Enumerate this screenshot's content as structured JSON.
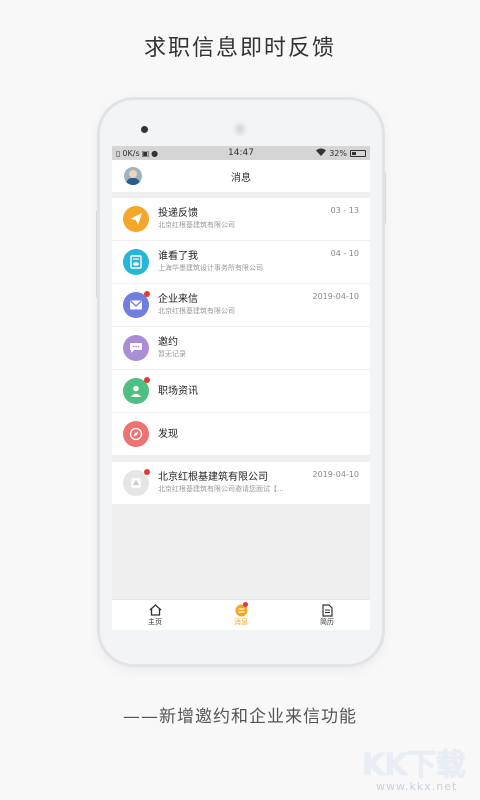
{
  "promo": {
    "headline": "求职信息即时反馈",
    "footline": "——新增邀约和企业来信功能"
  },
  "status_bar": {
    "net_speed": "0K/s",
    "time": "14:47",
    "battery": "32%"
  },
  "header": {
    "title": "消息"
  },
  "messages": [
    {
      "title": "投递反馈",
      "subtitle": "北京红根基建筑有限公司",
      "date": "03 - 13",
      "icon": "paper-plane-icon",
      "color": "#f5a72a",
      "unread": false
    },
    {
      "title": "谁看了我",
      "subtitle": "上海华墨建筑设计事务所有限公司",
      "date": "04 - 10",
      "icon": "eye-document-icon",
      "color": "#29b6d6",
      "unread": false
    },
    {
      "title": "企业来信",
      "subtitle": "北京红根基建筑有限公司",
      "date": "2019-04-10",
      "icon": "envelope-icon",
      "color": "#6f7ee0",
      "unread": true
    },
    {
      "title": "邀约",
      "subtitle": "暂无记录",
      "date": "",
      "icon": "chat-bubble-icon",
      "color": "#a98ed6",
      "unread": false
    },
    {
      "title": "职场资讯",
      "subtitle": "",
      "date": "",
      "icon": "person-icon",
      "color": "#4dbf80",
      "unread": true
    },
    {
      "title": "发现",
      "subtitle": "",
      "date": "",
      "icon": "compass-icon",
      "color": "#ef7272",
      "unread": false
    }
  ],
  "company_message": {
    "title": "北京红根基建筑有限公司",
    "subtitle": "北京红根基建筑有限公司邀请您面试【...",
    "date": "2019-04-10",
    "icon": "company-logo-icon",
    "unread": true
  },
  "tabs": [
    {
      "label": "主页",
      "icon": "home-icon",
      "active": false
    },
    {
      "label": "消息",
      "icon": "message-icon",
      "active": true
    },
    {
      "label": "简历",
      "icon": "resume-icon",
      "active": false
    }
  ],
  "watermark": {
    "big": "KK下载",
    "small": "www.kkx.net"
  },
  "colors": {
    "accent": "#f5a623",
    "unread_dot": "#e53935"
  }
}
